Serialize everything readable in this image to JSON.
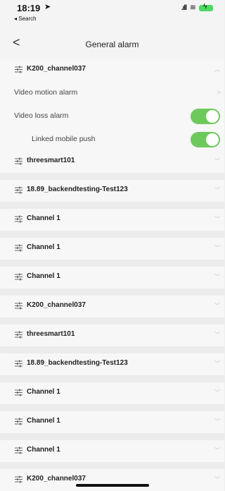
{
  "status_bar": {
    "time": "18:19",
    "back_app": "◂ Search"
  },
  "nav": {
    "title": "General alarm"
  },
  "expanded_group": {
    "title": "K200_channel037",
    "items": [
      {
        "label": "Video motion alarm",
        "control": "arrow"
      },
      {
        "label": "Video loss alarm",
        "control": "toggle",
        "on": true
      },
      {
        "label": "Linked mobile push",
        "control": "toggle",
        "on": true
      }
    ]
  },
  "groups": [
    "threesmart101",
    "18.89_backendtesting-Test123",
    "Channel 1",
    "Channel 1",
    "Channel 1",
    "K200_channel037",
    "threesmart101",
    "18.89_backendtesting-Test123",
    "Channel 1",
    "Channel 1",
    "Channel 1",
    "K200_channel037"
  ],
  "colors": {
    "toggle_on": "#6ec95d",
    "background": "#efefef"
  }
}
